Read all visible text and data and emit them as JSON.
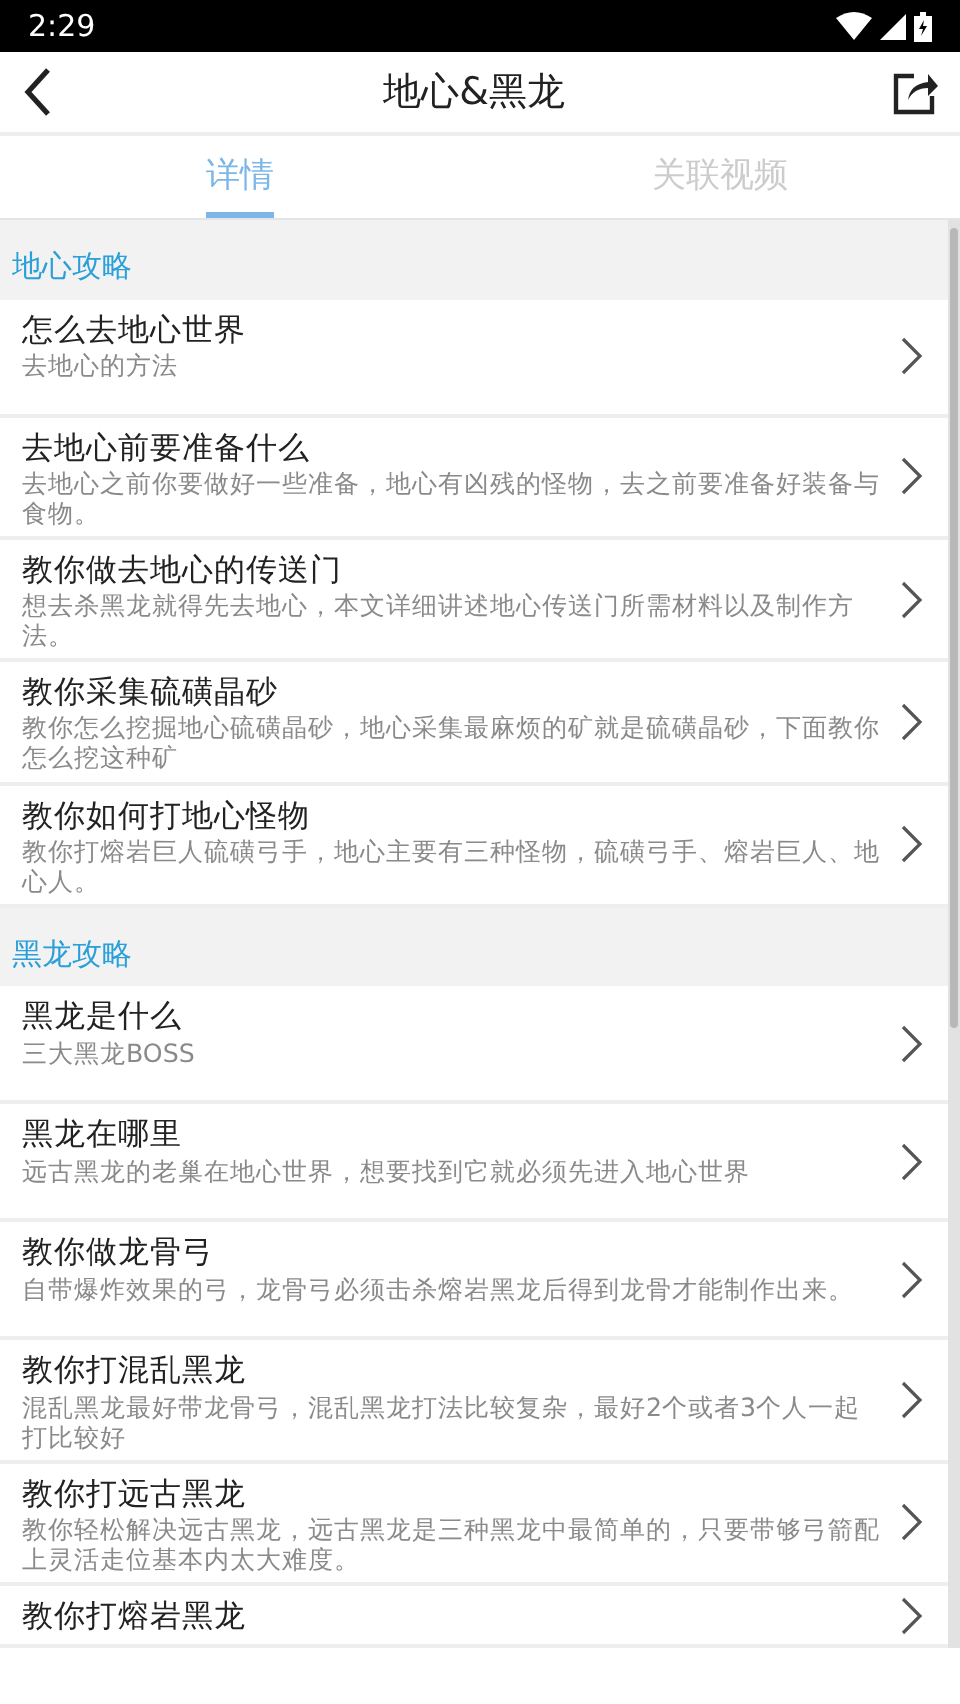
{
  "status_bar": {
    "time": "2:29"
  },
  "header": {
    "title": "地心&黑龙"
  },
  "tabs": [
    {
      "label": "详情",
      "selected": true
    },
    {
      "label": "关联视频",
      "selected": false
    }
  ],
  "sections": [
    {
      "title": "地心攻略",
      "items": [
        {
          "title": "怎么去地心世界",
          "subtitle": "去地心的方法"
        },
        {
          "title": "去地心前要准备什么",
          "subtitle": "去地心之前你要做好一些准备，地心有凶残的怪物，去之前要准备好装备与食物。"
        },
        {
          "title": "教你做去地心的传送门",
          "subtitle": "想去杀黑龙就得先去地心，本文详细讲述地心传送门所需材料以及制作方法。"
        },
        {
          "title": "教你采集硫磺晶砂",
          "subtitle": "教你怎么挖掘地心硫磺晶砂，地心采集最麻烦的矿就是硫磺晶砂，下面教你怎么挖这种矿"
        },
        {
          "title": "教你如何打地心怪物",
          "subtitle": "教你打熔岩巨人硫磺弓手，地心主要有三种怪物，硫磺弓手、熔岩巨人、地心人。"
        }
      ]
    },
    {
      "title": "黑龙攻略",
      "items": [
        {
          "title": "黑龙是什么",
          "subtitle": "三大黑龙BOSS"
        },
        {
          "title": "黑龙在哪里",
          "subtitle": "远古黑龙的老巢在地心世界，想要找到它就必须先进入地心世界"
        },
        {
          "title": "教你做龙骨弓",
          "subtitle": "自带爆炸效果的弓，龙骨弓必须击杀熔岩黑龙后得到龙骨才能制作出来。"
        },
        {
          "title": "教你打混乱黑龙",
          "subtitle": "混乱黑龙最好带龙骨弓，混乱黑龙打法比较复杂，最好2个或者3个人一起打比较好"
        },
        {
          "title": "教你打远古黑龙",
          "subtitle": "教你轻松解决远古黑龙，远古黑龙是三种黑龙中最简单的，只要带够弓箭配上灵活走位基本内太大难度。"
        },
        {
          "title": "教你打熔岩黑龙"
        }
      ]
    }
  ]
}
